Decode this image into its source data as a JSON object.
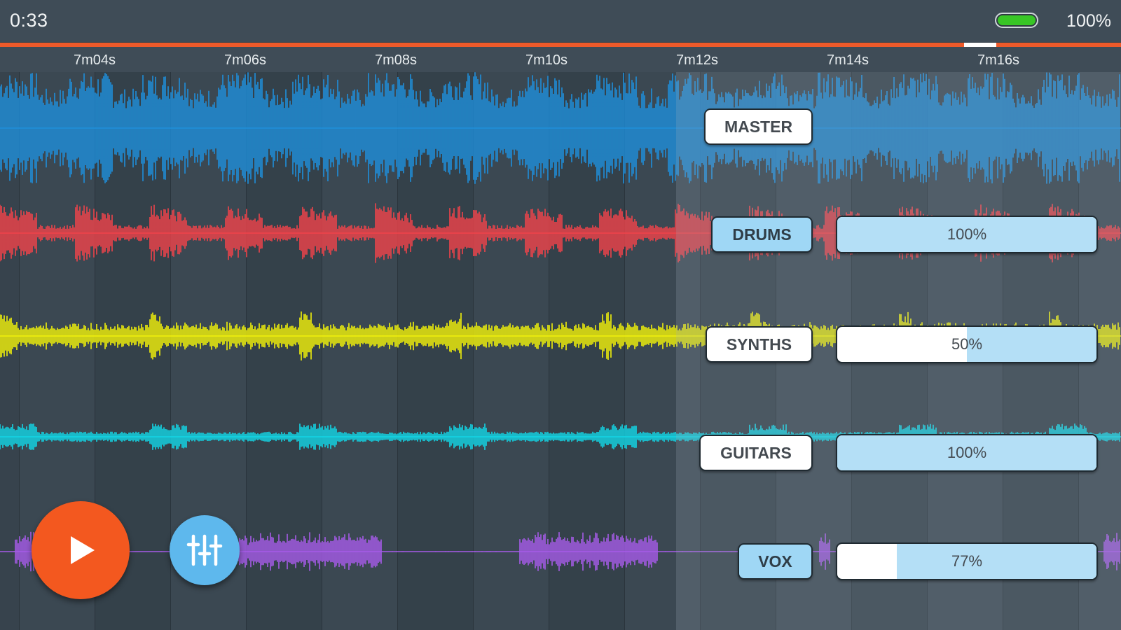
{
  "status": {
    "elapsed": "0:33",
    "battery_level": 1.0,
    "battery_label": "100%",
    "battery_color": "#38c626"
  },
  "playback": {
    "progress_color": "#ee5a2a",
    "position_fraction": 0.86
  },
  "timeline": {
    "ticks": [
      "7m04s",
      "7m06s",
      "7m08s",
      "7m10s",
      "7m12s",
      "7m14s",
      "7m16s"
    ],
    "playhead_fraction": 0.603
  },
  "tracks": [
    {
      "name": "MASTER",
      "color": "#1f8fdb",
      "style": "on",
      "volume": null,
      "volume_label": ""
    },
    {
      "name": "DRUMS",
      "color": "#f1434a",
      "style": "solo",
      "volume": 1.0,
      "volume_label": "100%"
    },
    {
      "name": "SYNTHS",
      "color": "#f2f20a",
      "style": "on",
      "volume": 0.5,
      "volume_label": "50%"
    },
    {
      "name": "GUITARS",
      "color": "#13d6e6",
      "style": "on",
      "volume": 1.0,
      "volume_label": "100%"
    },
    {
      "name": "VOX",
      "color": "#a65be8",
      "style": "solo",
      "volume": 0.77,
      "volume_label": "77%"
    }
  ],
  "controls": {
    "play_icon": "play-icon",
    "mixer_icon": "mixer-sliders-icon",
    "play_color": "#f3581f",
    "mixer_color": "#5eb8ed"
  }
}
